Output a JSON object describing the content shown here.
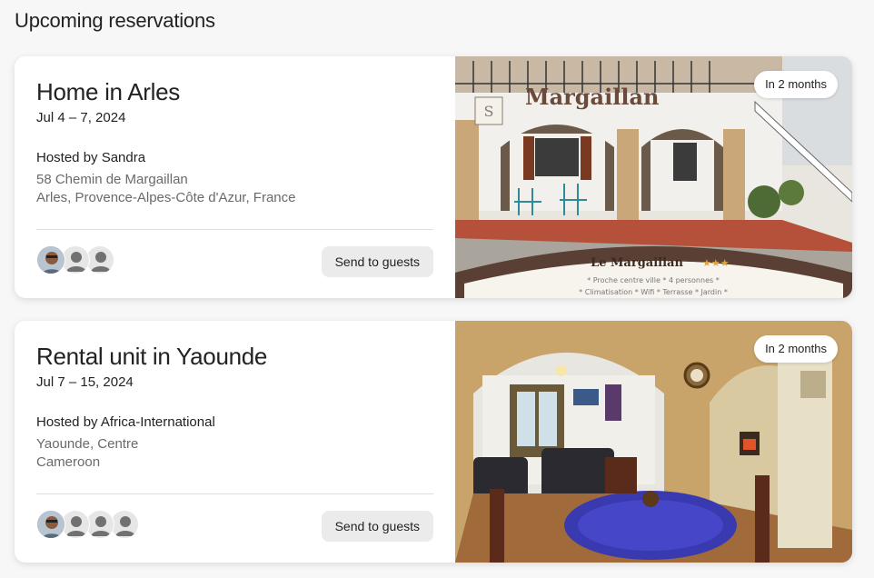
{
  "section": {
    "title": "Upcoming reservations"
  },
  "reservations": [
    {
      "title": "Home in Arles",
      "dates": "Jul 4 – 7, 2024",
      "host": "Hosted by Sandra",
      "address_line1": "58 Chemin de Margaillan",
      "address_line2": "Arles, Provence-Alpes-Côte d'Azur, France",
      "send_label": "Send to guests",
      "badge": "In 2 months",
      "guest_count": 3,
      "photo": {
        "sign_brand": "Margaillan",
        "banner_title": "Le Margaillan",
        "banner_stars": "★★★",
        "banner_line1": "* Proche centre ville * 4 personnes *",
        "banner_line2": "* Climatisation * Wifi * Terrasse * Jardin *"
      }
    },
    {
      "title": "Rental unit in Yaounde",
      "dates": "Jul 7 – 15, 2024",
      "host": "Hosted by Africa-International",
      "address_line1": "Yaounde, Centre",
      "address_line2": "Cameroon",
      "send_label": "Send to guests",
      "badge": "In 2 months",
      "guest_count": 4
    }
  ],
  "colors": {
    "text_primary": "#222222",
    "text_secondary": "#6a6a6a",
    "button_bg": "#ebebeb",
    "page_bg": "#f7f7f7"
  }
}
